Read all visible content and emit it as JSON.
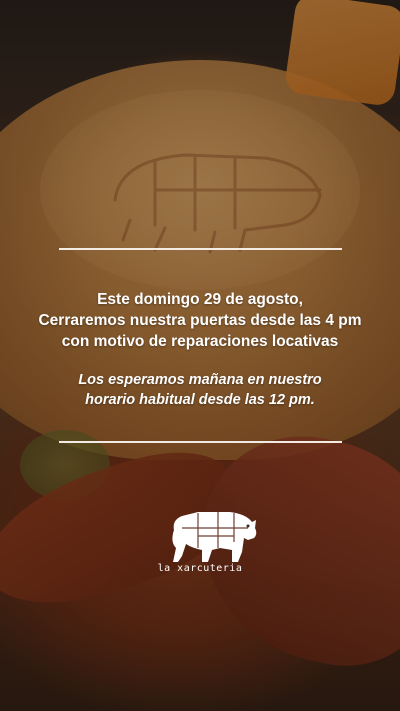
{
  "announcement": {
    "line1": "Este domingo 29 de agosto,",
    "line2": "Cerraremos nuestra puertas desde las 4 pm",
    "line3": "con motivo de reparaciones locativas"
  },
  "note": {
    "line1": "Los esperamos mañana en nuestro",
    "line2": "horario habitual desde las 12 pm."
  },
  "brand": {
    "name": "la xarcuteria",
    "logo_icon": "pig-icon"
  },
  "colors": {
    "text": "#ffffff",
    "rule": "#f3ece4"
  }
}
